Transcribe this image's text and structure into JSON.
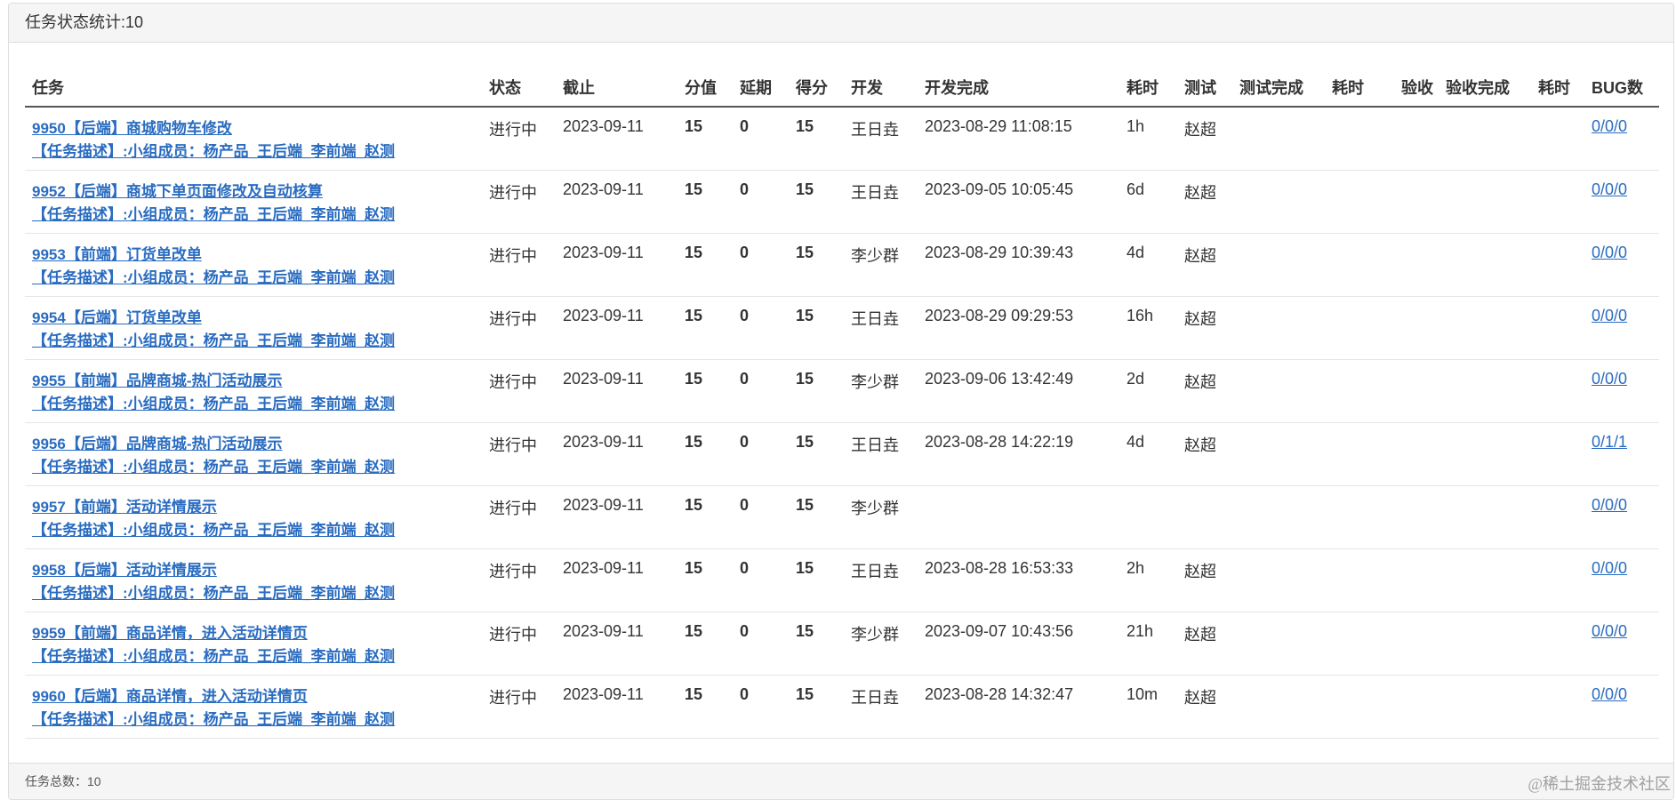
{
  "header": {
    "title": "任务状态统计:10"
  },
  "table": {
    "columns": [
      "任务",
      "状态",
      "截止",
      "分值",
      "延期",
      "得分",
      "开发",
      "开发完成",
      "耗时",
      "测试",
      "测试完成",
      "耗时",
      "验收",
      "验收完成",
      "耗时",
      "BUG数"
    ],
    "rows": [
      {
        "title": "9950【后端】商城购物车修改",
        "desc": "【任务描述】:小组成员：杨产品_王后端_李前端_赵测",
        "status": "进行中",
        "deadline": "2023-09-11",
        "score": "15",
        "delay": "0",
        "points": "15",
        "dev": "王日垚",
        "dev_done": "2023-08-29 11:08:15",
        "dev_time": "1h",
        "tester": "赵超",
        "test_done": "",
        "test_time": "",
        "acceptor": "",
        "accept_done": "",
        "accept_time": "",
        "bugs": "0/0/0"
      },
      {
        "title": "9952【后端】商城下单页面修改及自动核算",
        "desc": "【任务描述】:小组成员：杨产品_王后端_李前端_赵测",
        "status": "进行中",
        "deadline": "2023-09-11",
        "score": "15",
        "delay": "0",
        "points": "15",
        "dev": "王日垚",
        "dev_done": "2023-09-05 10:05:45",
        "dev_time": "6d",
        "tester": "赵超",
        "test_done": "",
        "test_time": "",
        "acceptor": "",
        "accept_done": "",
        "accept_time": "",
        "bugs": "0/0/0"
      },
      {
        "title": "9953【前端】订货单改单",
        "desc": "【任务描述】:小组成员：杨产品_王后端_李前端_赵测",
        "status": "进行中",
        "deadline": "2023-09-11",
        "score": "15",
        "delay": "0",
        "points": "15",
        "dev": "李少群",
        "dev_done": "2023-08-29 10:39:43",
        "dev_time": "4d",
        "tester": "赵超",
        "test_done": "",
        "test_time": "",
        "acceptor": "",
        "accept_done": "",
        "accept_time": "",
        "bugs": "0/0/0"
      },
      {
        "title": "9954【后端】订货单改单",
        "desc": "【任务描述】:小组成员：杨产品_王后端_李前端_赵测",
        "status": "进行中",
        "deadline": "2023-09-11",
        "score": "15",
        "delay": "0",
        "points": "15",
        "dev": "王日垚",
        "dev_done": "2023-08-29 09:29:53",
        "dev_time": "16h",
        "tester": "赵超",
        "test_done": "",
        "test_time": "",
        "acceptor": "",
        "accept_done": "",
        "accept_time": "",
        "bugs": "0/0/0"
      },
      {
        "title": "9955【前端】品牌商城-热门活动展示",
        "desc": "【任务描述】:小组成员：杨产品_王后端_李前端_赵测",
        "status": "进行中",
        "deadline": "2023-09-11",
        "score": "15",
        "delay": "0",
        "points": "15",
        "dev": "李少群",
        "dev_done": "2023-09-06 13:42:49",
        "dev_time": "2d",
        "tester": "赵超",
        "test_done": "",
        "test_time": "",
        "acceptor": "",
        "accept_done": "",
        "accept_time": "",
        "bugs": "0/0/0"
      },
      {
        "title": "9956【后端】品牌商城-热门活动展示",
        "desc": "【任务描述】:小组成员：杨产品_王后端_李前端_赵测",
        "status": "进行中",
        "deadline": "2023-09-11",
        "score": "15",
        "delay": "0",
        "points": "15",
        "dev": "王日垚",
        "dev_done": "2023-08-28 14:22:19",
        "dev_time": "4d",
        "tester": "赵超",
        "test_done": "",
        "test_time": "",
        "acceptor": "",
        "accept_done": "",
        "accept_time": "",
        "bugs": "0/1/1"
      },
      {
        "title": "9957【前端】活动详情展示",
        "desc": "【任务描述】:小组成员：杨产品_王后端_李前端_赵测",
        "status": "进行中",
        "deadline": "2023-09-11",
        "score": "15",
        "delay": "0",
        "points": "15",
        "dev": "李少群",
        "dev_done": "",
        "dev_time": "",
        "tester": "",
        "test_done": "",
        "test_time": "",
        "acceptor": "",
        "accept_done": "",
        "accept_time": "",
        "bugs": "0/0/0"
      },
      {
        "title": "9958【后端】活动详情展示",
        "desc": "【任务描述】:小组成员：杨产品_王后端_李前端_赵测",
        "status": "进行中",
        "deadline": "2023-09-11",
        "score": "15",
        "delay": "0",
        "points": "15",
        "dev": "王日垚",
        "dev_done": "2023-08-28 16:53:33",
        "dev_time": "2h",
        "tester": "赵超",
        "test_done": "",
        "test_time": "",
        "acceptor": "",
        "accept_done": "",
        "accept_time": "",
        "bugs": "0/0/0"
      },
      {
        "title": "9959【前端】商品详情，进入活动详情页",
        "desc": "【任务描述】:小组成员：杨产品_王后端_李前端_赵测",
        "status": "进行中",
        "deadline": "2023-09-11",
        "score": "15",
        "delay": "0",
        "points": "15",
        "dev": "李少群",
        "dev_done": "2023-09-07 10:43:56",
        "dev_time": "21h",
        "tester": "赵超",
        "test_done": "",
        "test_time": "",
        "acceptor": "",
        "accept_done": "",
        "accept_time": "",
        "bugs": "0/0/0"
      },
      {
        "title": "9960【后端】商品详情，进入活动详情页",
        "desc": "【任务描述】:小组成员：杨产品_王后端_李前端_赵测",
        "status": "进行中",
        "deadline": "2023-09-11",
        "score": "15",
        "delay": "0",
        "points": "15",
        "dev": "王日垚",
        "dev_done": "2023-08-28 14:32:47",
        "dev_time": "10m",
        "tester": "赵超",
        "test_done": "",
        "test_time": "",
        "acceptor": "",
        "accept_done": "",
        "accept_time": "",
        "bugs": "0/0/0"
      }
    ]
  },
  "footer": {
    "total": "任务总数：10"
  },
  "watermark": "@稀土掘金技术社区",
  "colors": {
    "link": "#2a6cc0",
    "heading_bg": "#f5f5f5",
    "border": "#dddddd"
  }
}
